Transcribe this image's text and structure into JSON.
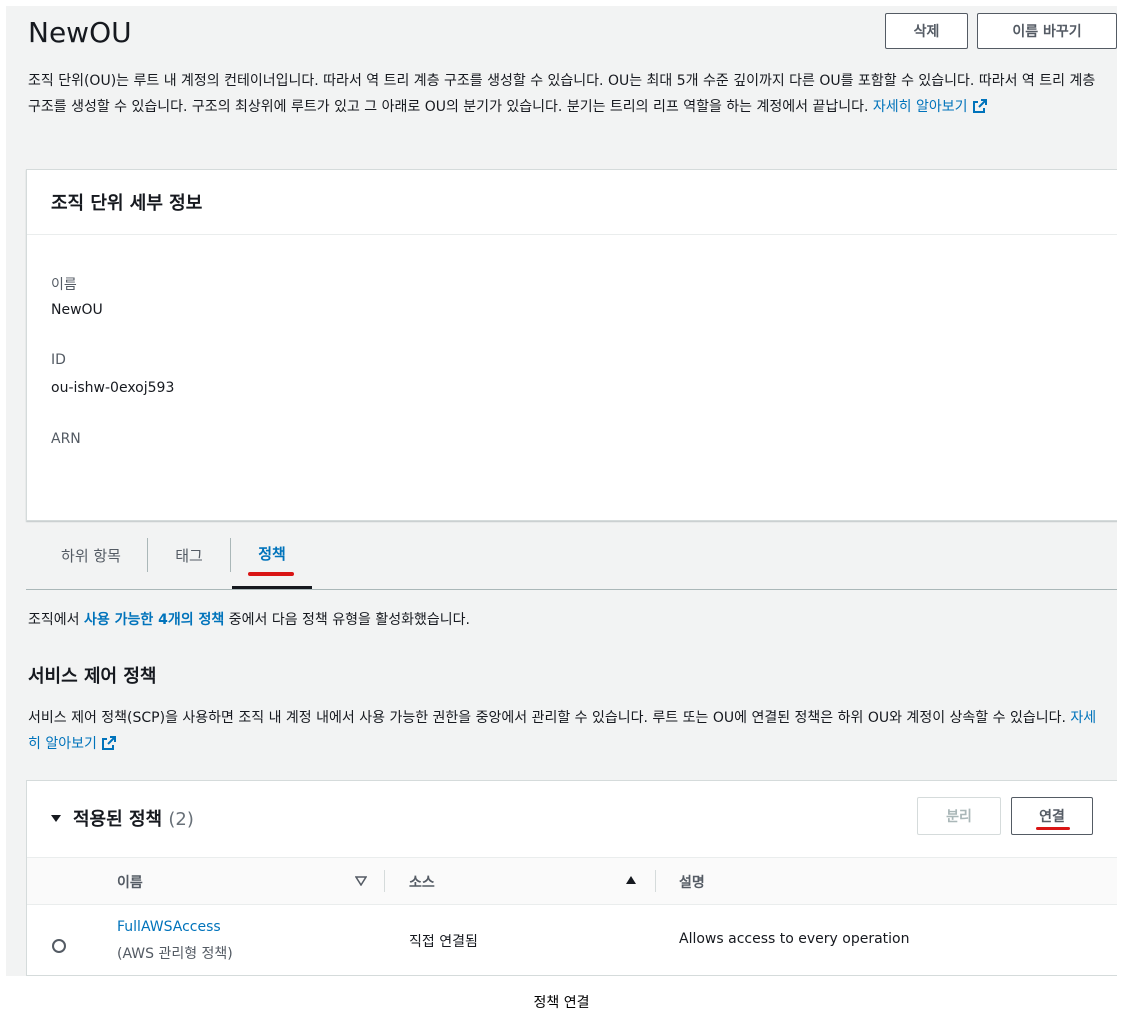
{
  "header": {
    "title": "NewOU",
    "delete_label": "삭제",
    "rename_label": "이름 바꾸기"
  },
  "intro": {
    "text": "조직 단위(OU)는 루트 내 계정의 컨테이너입니다. 따라서 역 트리 계층 구조를 생성할 수 있습니다. OU는 최대 5개 수준 깊이까지 다른 OU를 포함할 수 있습니다. 따라서 역 트리 계층 구조를 생성할 수 있습니다. 구조의 최상위에 루트가 있고 그 아래로 OU의 분기가 있습니다. 분기는 트리의 리프 역할을 하는 계정에서 끝납니다. ",
    "learn_more": "자세히 알아보기"
  },
  "details": {
    "title": "조직 단위 세부 정보",
    "name_label": "이름",
    "name_value": "NewOU",
    "id_label": "ID",
    "id_value": "ou-ishw-0exoj593",
    "arn_label": "ARN"
  },
  "tabs": [
    {
      "label": "하위 항목"
    },
    {
      "label": "태그"
    },
    {
      "label": "정책",
      "active": true
    }
  ],
  "policy_info": {
    "prefix": "조직에서 ",
    "link": "사용 가능한 4개의 정책",
    "suffix": " 중에서 다음 정책 유형을 활성화했습니다."
  },
  "scp": {
    "title": "서비스 제어 정책",
    "description": "서비스 제어 정책(SCP)을 사용하면 조직 내 계정 내에서 사용 가능한 권한을 중앙에서 관리할 수 있습니다. 루트 또는 OU에 연결된 정책은 하위 OU와 계정이 상속할 수 있습니다. ",
    "learn_more": "자세히 알아보기"
  },
  "attached": {
    "title": "적용된 정책",
    "count": "(2)",
    "detach_label": "분리",
    "attach_label": "연결",
    "columns": {
      "name": "이름",
      "source": "소스",
      "description": "설명"
    },
    "rows": [
      {
        "name": "FullAWSAccess",
        "type": "(AWS 관리형 정책)",
        "source": "직접 연결됨",
        "description": "Allows access to every operation"
      }
    ]
  },
  "caption": "정책 연결",
  "colors": {
    "link": "#0073bb",
    "annotation": "#d91515"
  }
}
